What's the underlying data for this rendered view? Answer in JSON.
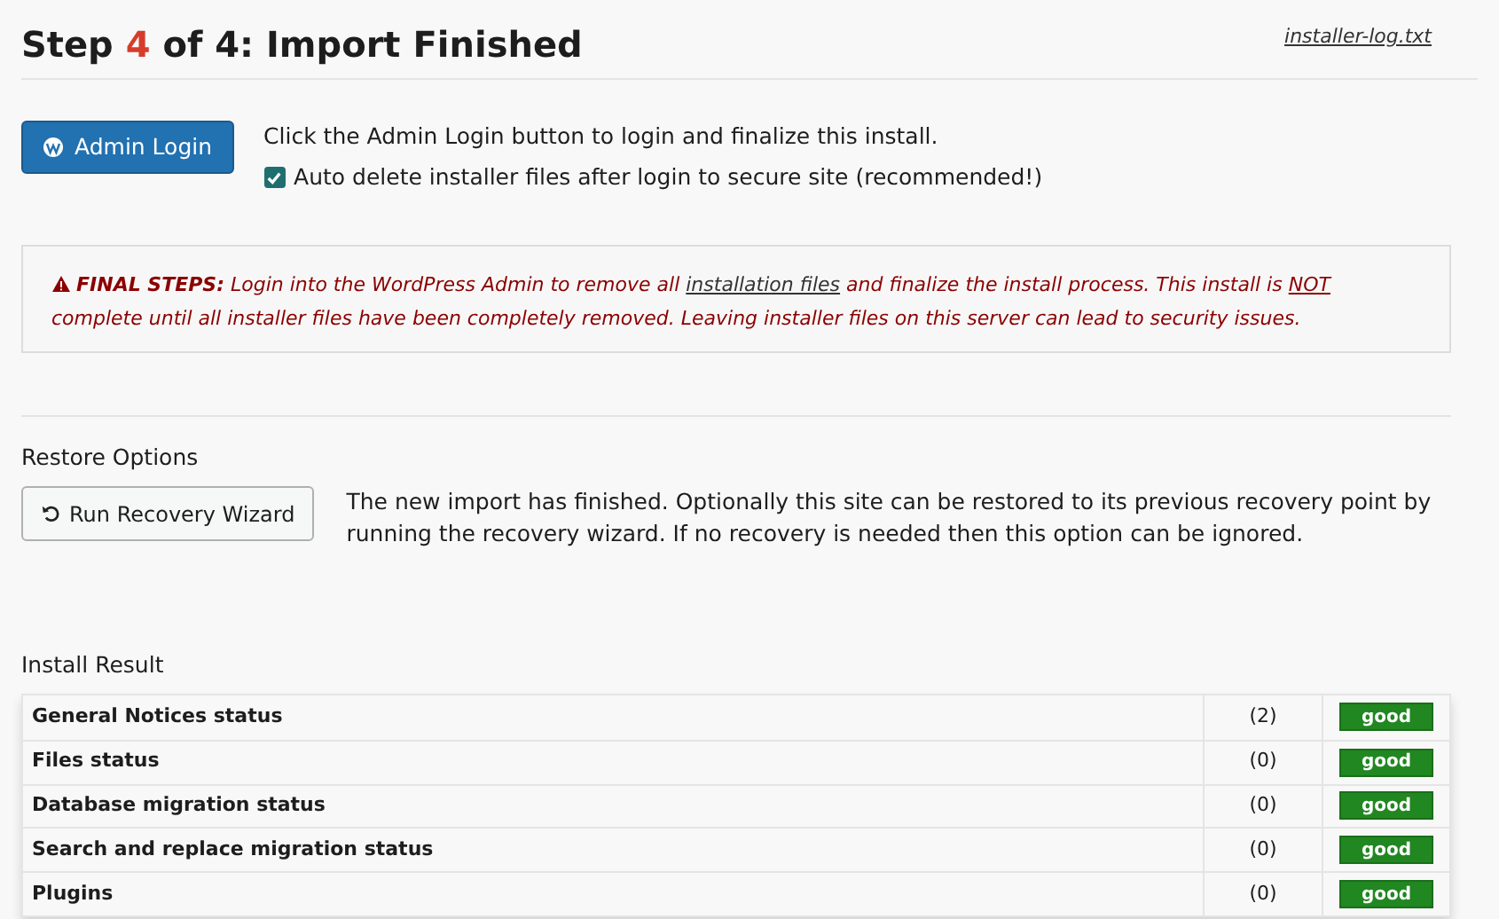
{
  "header": {
    "title_start": "Step ",
    "step": "4",
    "title_end": " of 4: Import Finished",
    "log_link": "installer-log.txt"
  },
  "login": {
    "button": "Admin Login",
    "instruction": "Click the Admin Login button to login and finalize this install.",
    "auto_delete": {
      "label": "Auto delete installer files after login to secure site (recommended!)",
      "checked": true
    }
  },
  "warning": {
    "parts": [
      {
        "kind": "bold",
        "text": "FINAL STEPS:"
      },
      {
        "kind": "plain",
        "text": " Login into the WordPress Admin to remove all "
      },
      {
        "kind": "link",
        "text": "installation files"
      },
      {
        "kind": "plain",
        "text": " and finalize the install process. This install is "
      },
      {
        "kind": "underline",
        "text": "NOT"
      },
      {
        "kind": "plain",
        "text": " complete until all installer files have been completely removed. Leaving installer files on this server can lead to security issues."
      }
    ]
  },
  "restore": {
    "heading": "Restore Options",
    "button": "Run Recovery Wizard",
    "description": "The new import has finished. Optionally this site can be restored to its previous recovery point by running the recovery wizard. If no recovery is needed then this option can be ignored."
  },
  "install_result": {
    "heading": "Install Result",
    "rows": [
      {
        "name": "General Notices status",
        "count": "(2)",
        "status": "good"
      },
      {
        "name": "Files status",
        "count": "(0)",
        "status": "good"
      },
      {
        "name": "Database migration status",
        "count": "(0)",
        "status": "good"
      },
      {
        "name": "Search and replace migration status",
        "count": "(0)",
        "status": "good"
      },
      {
        "name": "Plugins",
        "count": "(0)",
        "status": "good"
      }
    ]
  }
}
